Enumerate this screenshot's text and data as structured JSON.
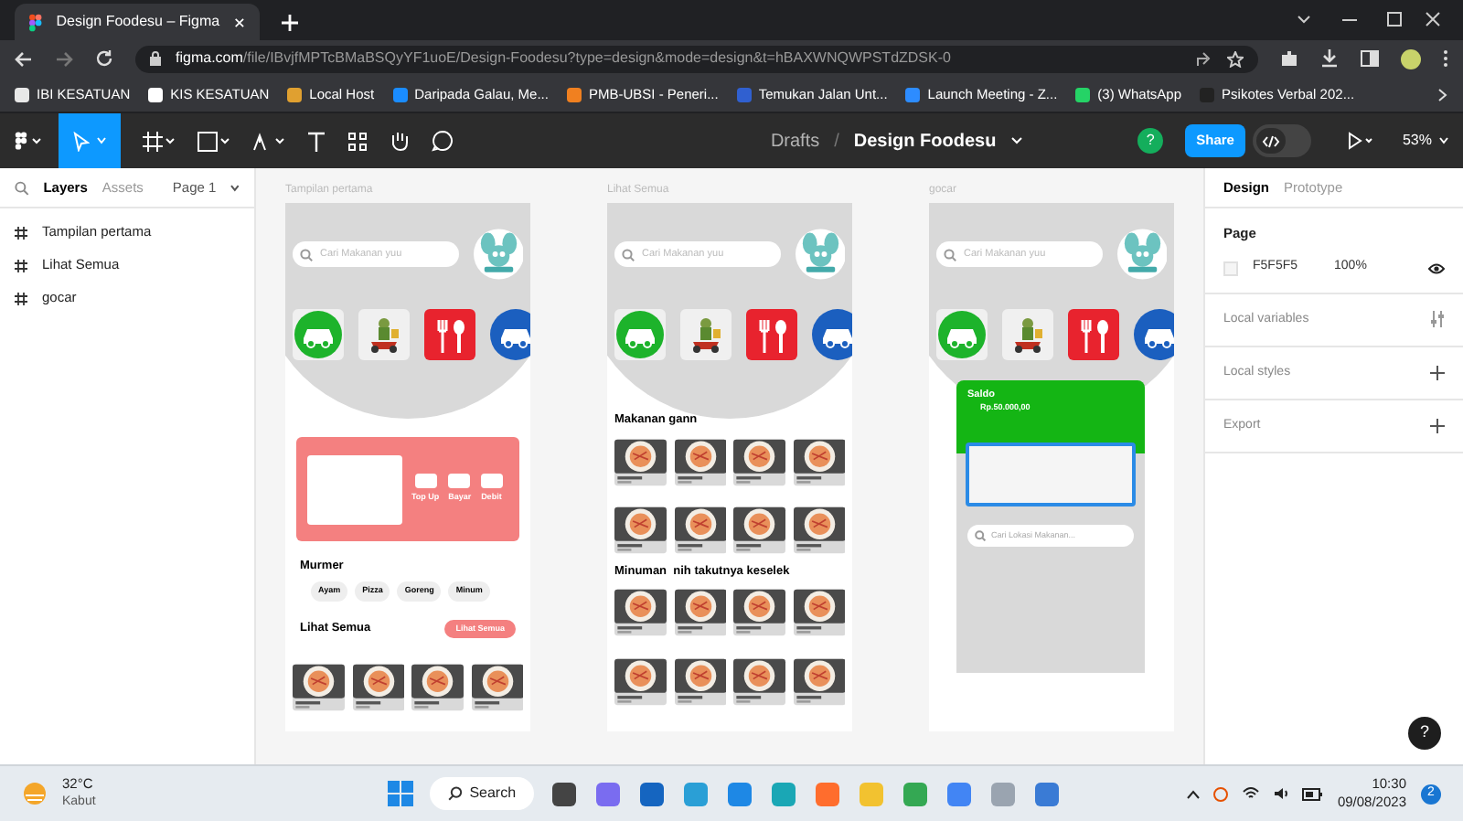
{
  "browser": {
    "tab_title": "Design Foodesu – Figma",
    "url_host": "figma.com",
    "url_path": "/file/IBvjfMPTcBMaBSQyYF1uoE/Design-Foodesu?type=design&mode=design&t=hBAXWNQWPSTdZDSK-0",
    "bookmarks": [
      "IBI KESATUAN",
      "KIS KESATUAN",
      "Local Host",
      "Daripada Galau, Me...",
      "PMB-UBSI - Peneri...",
      "Temukan Jalan Unt...",
      "Launch Meeting - Z...",
      "(3) WhatsApp",
      "Psikotes Verbal 202..."
    ]
  },
  "toolbar": {
    "breadcrumb": "Drafts",
    "separator": "/",
    "dev_mode_on": false,
    "file_name": "Design Foodesu",
    "avatar": "?",
    "share": "Share",
    "zoom": "53%"
  },
  "left_panel": {
    "tabs": [
      {
        "label": "Layers",
        "selected": true
      },
      {
        "label": "Assets",
        "selected": false
      }
    ],
    "page": "Page 1",
    "layers": [
      "Tampilan pertama",
      "Lihat Semua",
      "gocar"
    ]
  },
  "frames": [
    {
      "kind": "home",
      "title": "Tampilan pertama",
      "search_placeholder": "Cari Makanan yuu",
      "actions": [
        "Top Up",
        "Bayar",
        "Debit"
      ],
      "section_1": "Murmer",
      "chips": [
        "Ayam",
        "Pizza",
        "Goreng",
        "Minum"
      ],
      "section_2": "Lihat Semua",
      "see_all": "Lihat Semua"
    },
    {
      "kind": "list",
      "title": "Lihat Semua",
      "search_placeholder": "Cari Makanan yuu",
      "section_1": "Makanan gann",
      "section_2": "Minuman  nih takutnya keselek"
    },
    {
      "kind": "wallet",
      "title": "gocar",
      "search_placeholder": "Cari Makanan yuu",
      "balance_label": "Saldo",
      "balance": "Rp.50.000,00",
      "location_placeholder": "Cari Lokasi Makanan..."
    }
  ],
  "right_panel": {
    "tabs": [
      {
        "label": "Design",
        "selected": true
      },
      {
        "label": "Prototype",
        "selected": false
      }
    ],
    "page_heading": "Page",
    "page_color": "F5F5F5",
    "opacity": "100%",
    "sections": [
      {
        "label": "Local variables",
        "kind": "variables"
      },
      {
        "label": "Local styles",
        "kind": "add"
      },
      {
        "label": "Export",
        "kind": "add"
      }
    ],
    "help": "?"
  },
  "taskbar": {
    "temperature": "32°C",
    "weather": "Kabut",
    "search": "Search",
    "time": "10:30",
    "date": "09/08/2023",
    "notifications": "2"
  }
}
